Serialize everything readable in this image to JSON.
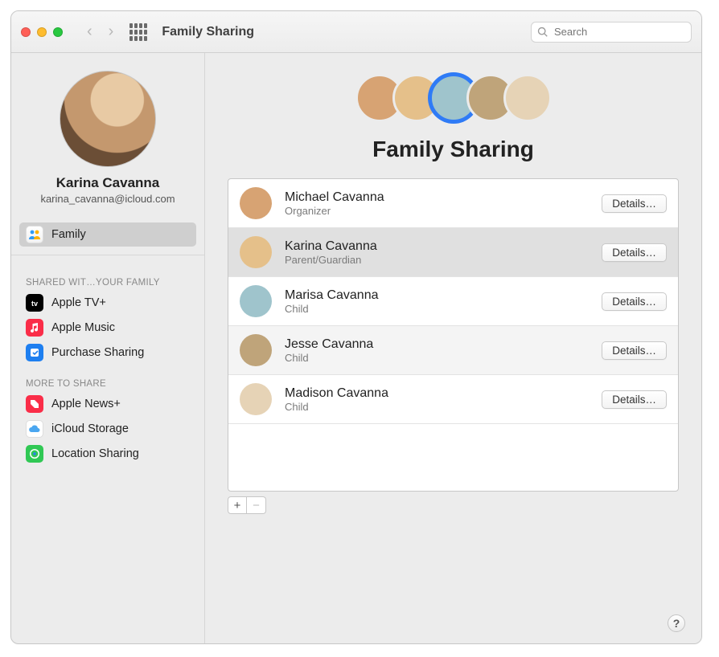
{
  "toolbar": {
    "title": "Family Sharing",
    "search_placeholder": "Search"
  },
  "sidebar": {
    "profile": {
      "name": "Karina Cavanna",
      "email": "karina_cavanna@icloud.com"
    },
    "family_label": "Family",
    "shared_header": "SHARED WIT…YOUR FAMILY",
    "shared": [
      {
        "label": "Apple TV+",
        "color": "#000"
      },
      {
        "label": "Apple Music",
        "color": "#fa2d48"
      },
      {
        "label": "Purchase Sharing",
        "color": "#1e7ff0"
      }
    ],
    "more_header": "MORE TO SHARE",
    "more": [
      {
        "label": "Apple News+",
        "color": "#fa2d48"
      },
      {
        "label": "iCloud Storage",
        "color": "#ffffff"
      },
      {
        "label": "Location Sharing",
        "color": "#30c854"
      }
    ]
  },
  "main": {
    "title": "Family Sharing",
    "details_label": "Details…",
    "members": [
      {
        "name": "Michael Cavanna",
        "role": "Organizer",
        "color": "#d7a373"
      },
      {
        "name": "Karina Cavanna",
        "role": "Parent/Guardian",
        "color": "#e5c08a",
        "selected": true
      },
      {
        "name": "Marisa Cavanna",
        "role": "Child",
        "color": "#9fc4cc"
      },
      {
        "name": "Jesse Cavanna",
        "role": "Child",
        "color": "#bfa47a"
      },
      {
        "name": "Madison Cavanna",
        "role": "Child",
        "color": "#e6d3b6"
      }
    ],
    "add_label": "+",
    "remove_label": "−",
    "help_label": "?"
  }
}
